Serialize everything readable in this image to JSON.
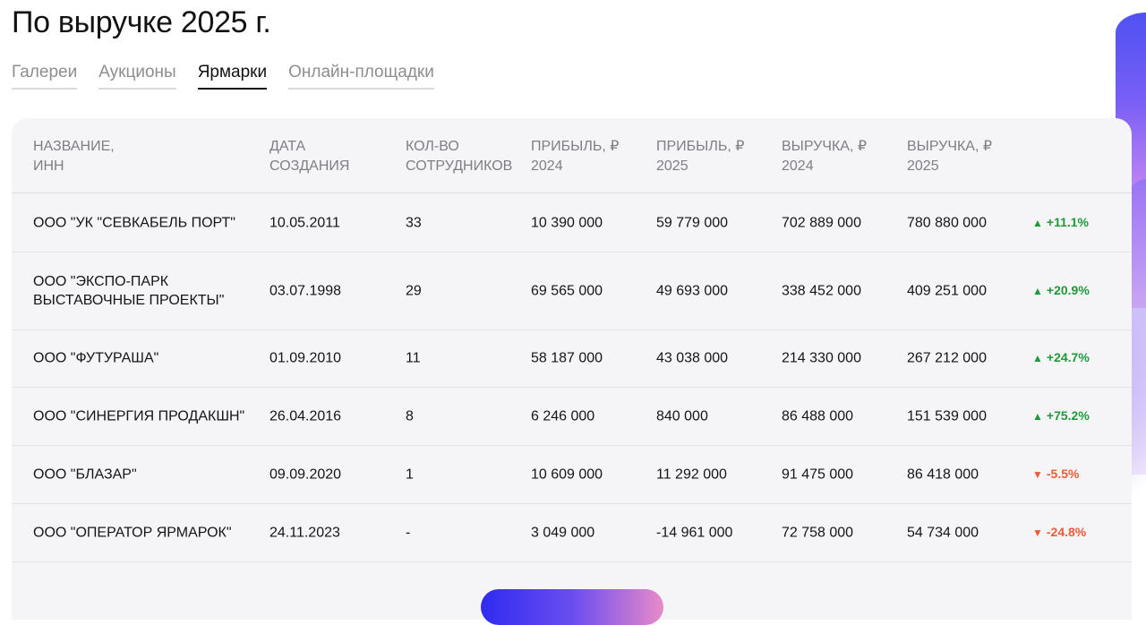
{
  "page": {
    "title": "По выручке 2025 г."
  },
  "tabs": [
    {
      "label": "Галереи",
      "active": false
    },
    {
      "label": "Аукционы",
      "active": false
    },
    {
      "label": "Ярмарки",
      "active": true
    },
    {
      "label": "Онлайн-площадки",
      "active": false
    }
  ],
  "table": {
    "headers": {
      "name": [
        "НАЗВАНИЕ,",
        "ИНН"
      ],
      "date": [
        "ДАТА",
        "СОЗДАНИЯ"
      ],
      "employees": [
        "КОЛ-ВО",
        "СОТРУДНИКОВ"
      ],
      "profit_2024": [
        "ПРИБЫЛЬ, ₽",
        "2024"
      ],
      "profit_2025": [
        "ПРИБЫЛЬ, ₽",
        "2025"
      ],
      "revenue_2024": [
        "ВЫРУЧКА, ₽",
        "2024"
      ],
      "revenue_2025": [
        "ВЫРУЧКА, ₽",
        "2025"
      ]
    },
    "rows": [
      {
        "name": "ООО \"УК \"СЕВКАБЕЛЬ ПОРТ\"",
        "date": "10.05.2011",
        "employees": "33",
        "profit_2024": "10 390 000",
        "profit_2025": "59 779 000",
        "revenue_2024": "702 889 000",
        "revenue_2025": "780 880 000",
        "change": "+11.1%",
        "trend": "up",
        "arrow": "▲"
      },
      {
        "name": "ООО \"ЭКСПО-ПАРК ВЫСТАВОЧНЫЕ ПРОЕКТЫ\"",
        "date": "03.07.1998",
        "employees": "29",
        "profit_2024": "69 565 000",
        "profit_2025": "49 693 000",
        "revenue_2024": "338 452 000",
        "revenue_2025": "409 251 000",
        "change": "+20.9%",
        "trend": "up",
        "arrow": "▲"
      },
      {
        "name": "ООО \"ФУТУРАША\"",
        "date": "01.09.2010",
        "employees": "11",
        "profit_2024": "58 187 000",
        "profit_2025": "43 038 000",
        "revenue_2024": "214 330 000",
        "revenue_2025": "267 212 000",
        "change": "+24.7%",
        "trend": "up",
        "arrow": "▲"
      },
      {
        "name": "ООО \"СИНЕРГИЯ ПРОДАКШН\"",
        "date": "26.04.2016",
        "employees": "8",
        "profit_2024": "6 246 000",
        "profit_2025": "840 000",
        "revenue_2024": "86 488 000",
        "revenue_2025": "151 539 000",
        "change": "+75.2%",
        "trend": "up",
        "arrow": "▲"
      },
      {
        "name": "ООО \"БЛАЗАР\"",
        "date": "09.09.2020",
        "employees": "1",
        "profit_2024": "10 609 000",
        "profit_2025": "11 292 000",
        "revenue_2024": "91 475 000",
        "revenue_2025": "86 418 000",
        "change": "-5.5%",
        "trend": "down",
        "arrow": "▼"
      },
      {
        "name": "ООО \"ОПЕРАТОР ЯРМАРОК\"",
        "date": "24.11.2023",
        "employees": "-",
        "profit_2024": "3 049 000",
        "profit_2025": "-14 961 000",
        "revenue_2024": "72 758 000",
        "revenue_2025": "54 734 000",
        "change": "-24.8%",
        "trend": "down",
        "arrow": "▼"
      }
    ]
  },
  "colors": {
    "up": "#1e9a3b",
    "down": "#ef5a3a",
    "accent": "#2f2bf0"
  }
}
